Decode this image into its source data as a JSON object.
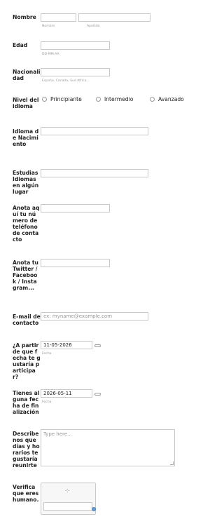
{
  "name": {
    "label": "Nombre",
    "first_sub": "Nombre",
    "last_sub": "Apellido"
  },
  "age": {
    "label": "Edad",
    "sub": "DD-MM-AA"
  },
  "nationality": {
    "label": "Nacionalidad",
    "sub": "España, Canada, Sud Africa..."
  },
  "level": {
    "label": "Nivel del idioma",
    "options": [
      "Principiante",
      "Intermedio",
      "Avanzado"
    ]
  },
  "native_language": {
    "label": "Idioma de Nacimiento"
  },
  "studied": {
    "label": "Estudias Idiomas en algún lugar"
  },
  "phone": {
    "label": "Anota aquí tu número de teléfono de contacto"
  },
  "social": {
    "label": "Anota tu Twitter / Facebook / Instagram..."
  },
  "email": {
    "label": "E-mail de contacto",
    "placeholder": "ex: myname@example.com"
  },
  "start_date": {
    "label": "¿A partir de que fecha te gustaría participar?",
    "value": "11-05-2026",
    "sub": "Fecha"
  },
  "end_date": {
    "label": "Tienes alguna fecha de finalización",
    "value": "2026-05-11",
    "sub": "Fecha"
  },
  "schedule": {
    "label": "Describenos que días y horarios te gustaría reunirte",
    "placeholder": "Type here..."
  },
  "captcha": {
    "label": "Verifica que eres humano.",
    "spinner_icon": "spinner-icon",
    "reload_icon": "reload-icon"
  }
}
